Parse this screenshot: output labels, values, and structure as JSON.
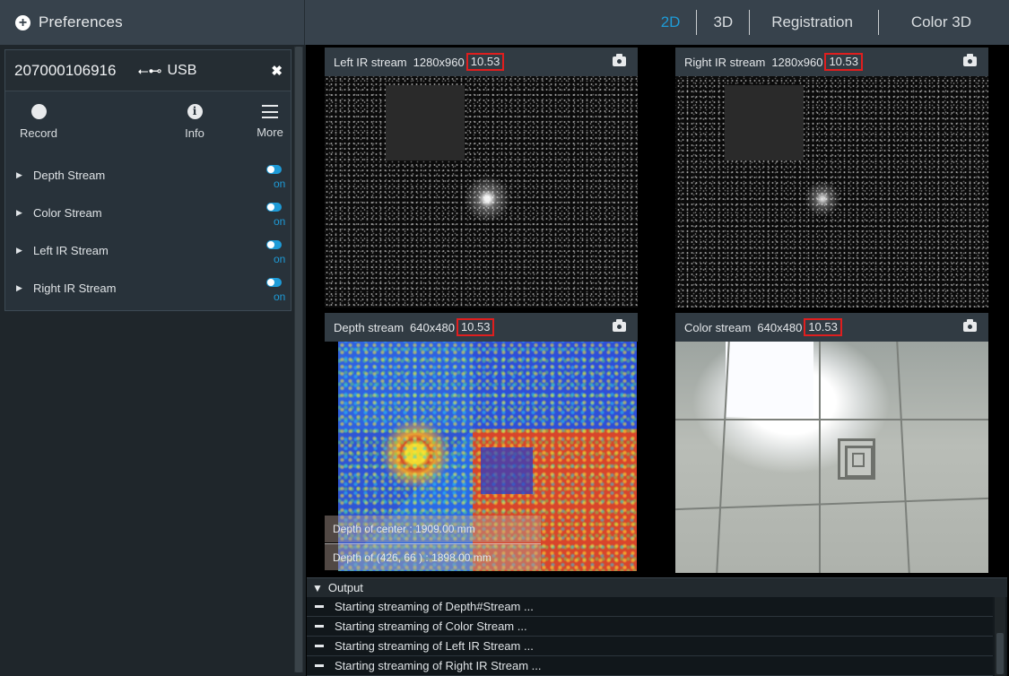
{
  "topbar": {
    "preferences_label": "Preferences",
    "tabs": [
      "2D",
      "3D",
      "Registration",
      "Color 3D"
    ],
    "active_tab": "2D"
  },
  "device": {
    "serial": "207000106916",
    "connection": "USB",
    "actions": [
      {
        "label": "Record",
        "icon": "record-icon"
      },
      {
        "label": "Info",
        "icon": "info-icon"
      },
      {
        "label": "More",
        "icon": "menu-icon"
      }
    ],
    "streams": [
      {
        "name": "Depth Stream",
        "state": "on"
      },
      {
        "name": "Color Stream",
        "state": "on"
      },
      {
        "name": "Left IR Stream",
        "state": "on"
      },
      {
        "name": "Right IR Stream",
        "state": "on"
      }
    ]
  },
  "panels": {
    "left_ir": {
      "title": "Left IR stream",
      "resolution": "1280x960",
      "fps": "10.53"
    },
    "right_ir": {
      "title": "Right IR stream",
      "resolution": "1280x960",
      "fps": "10.53"
    },
    "depth": {
      "title": "Depth stream",
      "resolution": "640x480",
      "fps": "10.53",
      "center_text": "Depth of center : 1909.00   mm",
      "point_text": "Depth of (426, 66 ) : 1898.00   mm"
    },
    "color": {
      "title": "Color stream",
      "resolution": "640x480",
      "fps": "10.53"
    }
  },
  "output": {
    "title": "Output",
    "lines": [
      "Starting streaming of Depth#Stream ...",
      "Starting streaming of Color Stream ...",
      "Starting streaming of Left IR Stream ...",
      "Starting streaming of Right IR Stream ..."
    ]
  },
  "colors": {
    "accent": "#1e9bd7",
    "fps_highlight": "#e01e1e"
  }
}
